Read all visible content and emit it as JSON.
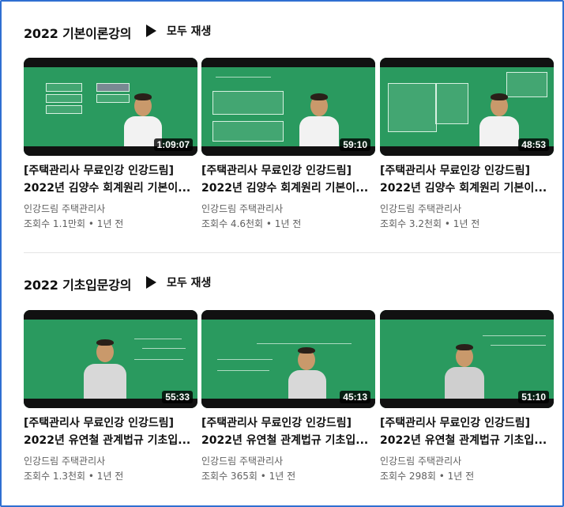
{
  "sections": [
    {
      "title": "2022 기본이론강의",
      "play_all": "모두 재생",
      "videos": [
        {
          "duration": "1:09:07",
          "title1": "[주택관리사 무료인강 인강드림]",
          "title2": "2022년 김양수 회계원리 기본이...",
          "channel": "인강드림 주택관리사",
          "meta": "조회수 1.1만회 • 1년 전"
        },
        {
          "duration": "59:10",
          "title1": "[주택관리사 무료인강 인강드림]",
          "title2": "2022년 김양수 회계원리 기본이...",
          "channel": "인강드림 주택관리사",
          "meta": "조회수 4.6천회 • 1년 전"
        },
        {
          "duration": "48:53",
          "title1": "[주택관리사 무료인강 인강드림]",
          "title2": "2022년 김양수 회계원리 기본이...",
          "channel": "인강드림 주택관리사",
          "meta": "조회수 3.2천회 • 1년 전"
        }
      ]
    },
    {
      "title": "2022 기초입문강의",
      "play_all": "모두 재생",
      "videos": [
        {
          "duration": "55:33",
          "title1": "[주택관리사 무료인강 인강드림]",
          "title2": "2022년 유연철 관계법규 기초입...",
          "channel": "인강드림 주택관리사",
          "meta": "조회수 1.3천회 • 1년 전"
        },
        {
          "duration": "45:13",
          "title1": "[주택관리사 무료인강 인강드림]",
          "title2": "2022년 유연철 관계법규 기초입...",
          "channel": "인강드림 주택관리사",
          "meta": "조회수 365회 • 1년 전"
        },
        {
          "duration": "51:10",
          "title1": "[주택관리사 무료인강 인강드림]",
          "title2": "2022년 유연철 관계법규 기초입...",
          "channel": "인강드림 주택관리사",
          "meta": "조회수 298회 • 1년 전"
        }
      ]
    }
  ],
  "colors": {
    "border": "#2f6fd1",
    "board": "#2a9a5f",
    "meta_text": "#606060"
  }
}
